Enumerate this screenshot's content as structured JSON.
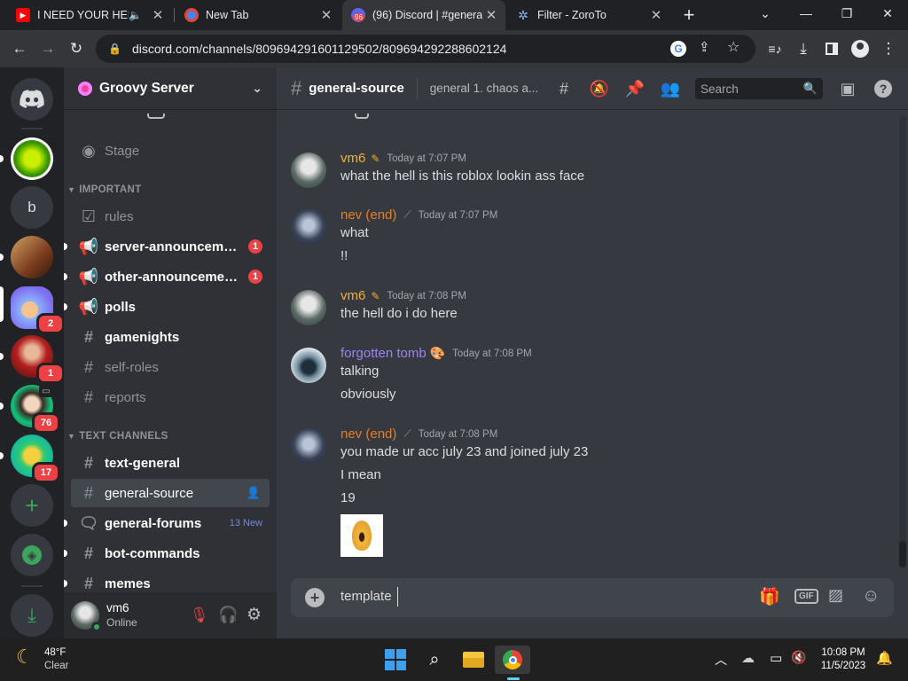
{
  "browser": {
    "tabs": [
      {
        "title": "I NEED YOUR HEL",
        "favicon": "youtube-icon"
      },
      {
        "title": "New Tab",
        "favicon": "chrome-icon"
      },
      {
        "title": "(96) Discord | #genera",
        "favicon": "discord-icon",
        "favicon_badge": "96",
        "active": true
      },
      {
        "title": "Filter - ZoroTo",
        "favicon": "zoro-icon"
      }
    ],
    "url": "discord.com/channels/809694291601129502/809694292288602124"
  },
  "guilds": {
    "home_icon": "discord-logo-icon",
    "servers": [
      {
        "label": "",
        "badge": ""
      },
      {
        "label": "b",
        "badge": ""
      },
      {
        "label": "",
        "badge": ""
      },
      {
        "label": "",
        "badge": "2"
      },
      {
        "label": "",
        "badge": "1"
      },
      {
        "label": "",
        "badge": "76"
      },
      {
        "label": "",
        "badge": "17"
      }
    ]
  },
  "sidebar": {
    "server_name": "Groovy Server",
    "channels": [
      {
        "name": "Stage",
        "icon": "stage-icon",
        "state": "muted"
      },
      {
        "category": "IMPORTANT"
      },
      {
        "name": "rules",
        "icon": "rules-icon",
        "state": "muted"
      },
      {
        "name": "server-announceme...",
        "icon": "megaphone-icon",
        "state": "unread",
        "badge": "1"
      },
      {
        "name": "other-announcemen...",
        "icon": "megaphone-icon",
        "state": "unread",
        "badge": "1"
      },
      {
        "name": "polls",
        "icon": "megaphone-icon",
        "state": "unread"
      },
      {
        "name": "gamenights",
        "icon": "hash-icon",
        "state": "unread"
      },
      {
        "name": "self-roles",
        "icon": "hash-icon",
        "state": "muted"
      },
      {
        "name": "reports",
        "icon": "hash-icon",
        "state": "muted"
      },
      {
        "category": "TEXT CHANNELS"
      },
      {
        "name": "text-general",
        "icon": "hash-icon",
        "state": "unread"
      },
      {
        "name": "general-source",
        "icon": "hash-icon",
        "state": "selected"
      },
      {
        "name": "general-forums",
        "icon": "forum-icon",
        "state": "unread",
        "new": "13 New"
      },
      {
        "name": "bot-commands",
        "icon": "hash-icon",
        "state": "unread"
      },
      {
        "name": "memes",
        "icon": "hash-icon",
        "state": "unread"
      }
    ],
    "user": {
      "name": "vm6",
      "status": "Online"
    }
  },
  "header": {
    "channel": "general-source",
    "topic": "general 1. chaos a...",
    "search_placeholder": "Search"
  },
  "messages": [
    {
      "author": "vm6",
      "color": "#f0b232",
      "time": "Today at 7:07 PM",
      "lines": [
        "what the hell is this roblox lookin ass face"
      ]
    },
    {
      "author": "nev (end)",
      "color": "#e67e22",
      "time": "Today at 7:07 PM",
      "lines": [
        "what",
        "!!"
      ]
    },
    {
      "author": "vm6",
      "color": "#f0b232",
      "time": "Today at 7:08 PM",
      "lines": [
        "the hell do i do here"
      ]
    },
    {
      "author": "forgotten tomb",
      "color": "#9b84ee",
      "time": "Today at 7:08 PM",
      "lines": [
        "talking",
        "obviously"
      ]
    },
    {
      "author": "nev (end)",
      "color": "#e67e22",
      "time": "Today at 7:08 PM",
      "lines": [
        "you made ur acc july 23 and joined july 23",
        "I mean",
        "19"
      ]
    }
  ],
  "composer": {
    "value": "template"
  },
  "taskbar": {
    "temp": "48°F",
    "weather": "Clear",
    "time": "10:08 PM",
    "date": "11/5/2023"
  }
}
